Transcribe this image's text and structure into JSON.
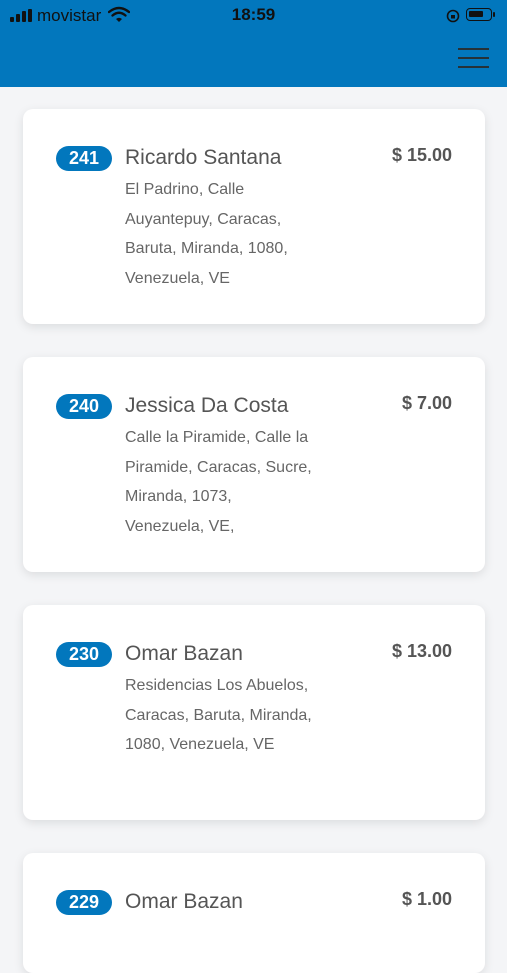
{
  "status_bar": {
    "carrier": "movistar",
    "time": "18:59"
  },
  "orders": [
    {
      "number": "241",
      "name": "Ricardo Santana",
      "price": "$ 15.00",
      "address": "El Padrino, Calle Auyantepuy, Caracas, Baruta, Miranda, 1080, Venezuela, VE"
    },
    {
      "number": "240",
      "name": "Jessica Da Costa",
      "price": "$ 7.00",
      "address": "Calle la Piramide, Calle la Piramide, Caracas, Sucre, Miranda, 1073, Venezuela, VE,"
    },
    {
      "number": "230",
      "name": "Omar Bazan",
      "price": "$ 13.00",
      "address": "Residencias Los Abuelos, Caracas, Baruta, Miranda, 1080, Venezuela, VE"
    },
    {
      "number": "229",
      "name": "Omar Bazan",
      "price": "$ 1.00",
      "address": ""
    }
  ],
  "colors": {
    "header": "#0277bd",
    "badge": "#0277bd",
    "background": "#f4f5f7"
  },
  "icons": [
    "signal-icon",
    "wifi-icon",
    "orientation-lock-icon",
    "battery-icon",
    "menu-icon"
  ]
}
